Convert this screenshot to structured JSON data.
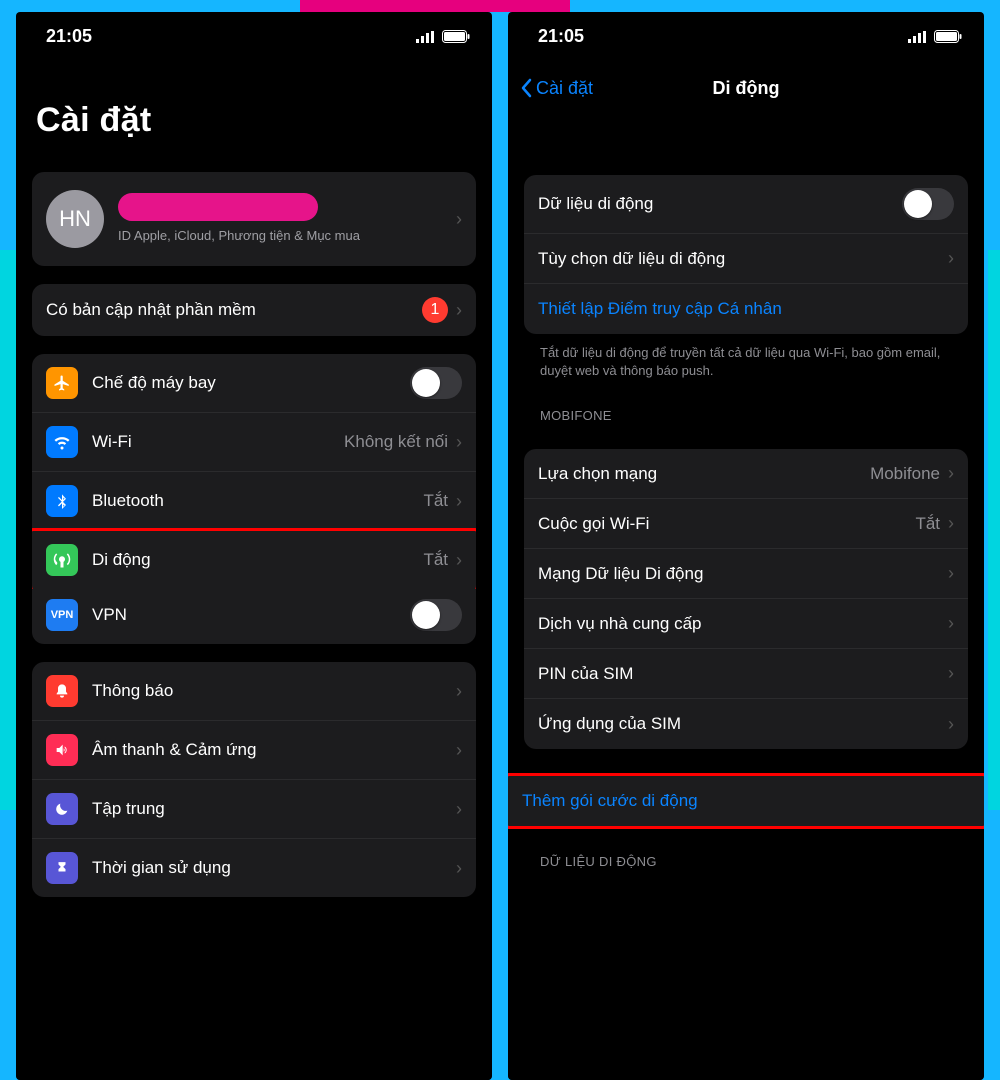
{
  "left": {
    "status": {
      "time": "21:05"
    },
    "title": "Cài đặt",
    "account": {
      "avatar_initials": "HN",
      "subtitle": "ID Apple, iCloud, Phương tiện & Mục mua"
    },
    "update_row": {
      "label": "Có bản cập nhật phần mềm",
      "badge": "1"
    },
    "group1": [
      {
        "key": "airplane",
        "label": "Chế độ máy bay",
        "toggle": false
      },
      {
        "key": "wifi",
        "label": "Wi-Fi",
        "value": "Không kết nối"
      },
      {
        "key": "bluetooth",
        "label": "Bluetooth",
        "value": "Tắt"
      },
      {
        "key": "cellular",
        "label": "Di động",
        "value": "Tắt",
        "highlight": true
      },
      {
        "key": "vpn",
        "label": "VPN",
        "toggle": false
      }
    ],
    "group2": [
      {
        "key": "notifications",
        "label": "Thông báo"
      },
      {
        "key": "sounds",
        "label": "Âm thanh & Cảm ứng"
      },
      {
        "key": "focus",
        "label": "Tập trung"
      },
      {
        "key": "screen_time",
        "label": "Thời gian sử dụng"
      }
    ]
  },
  "right": {
    "status": {
      "time": "21:05"
    },
    "back_label": "Cài đặt",
    "title": "Di động",
    "group1": {
      "rows": {
        "data_toggle": {
          "label": "Dữ liệu di động",
          "on": false
        },
        "data_options": {
          "label": "Tùy chọn dữ liệu di động"
        },
        "hotspot": {
          "label": "Thiết lập Điểm truy cập Cá nhân"
        }
      },
      "footer": "Tắt dữ liệu di động để truyền tất cả dữ liệu qua Wi-Fi, bao gồm email, duyệt web và thông báo push."
    },
    "carrier_header": "MOBIFONE",
    "group2": [
      {
        "label": "Lựa chọn mạng",
        "value": "Mobifone"
      },
      {
        "label": "Cuộc gọi Wi-Fi",
        "value": "Tắt"
      },
      {
        "label": "Mạng Dữ liệu Di động"
      },
      {
        "label": "Dịch vụ nhà cung cấp"
      },
      {
        "label": "PIN của SIM"
      },
      {
        "label": "Ứng dụng của SIM"
      }
    ],
    "add_plan": {
      "label": "Thêm gói cước di động"
    },
    "data_usage_header": "DỮ LIỆU DI ĐỘNG"
  }
}
